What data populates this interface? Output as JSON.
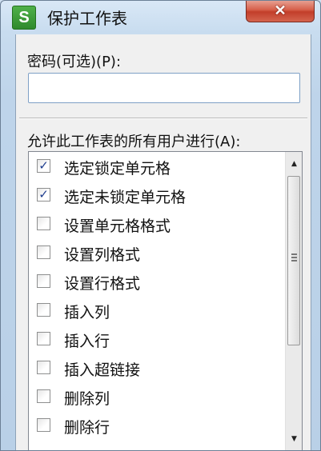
{
  "window": {
    "title": "保护工作表",
    "app_logo": "S",
    "close_symbol": "✕"
  },
  "password": {
    "label": "密码(可选)(P):",
    "value": "",
    "placeholder": ""
  },
  "permissions": {
    "label": "允许此工作表的所有用户进行(A):",
    "items": [
      {
        "label": "选定锁定单元格",
        "checked": true,
        "mark": "✓"
      },
      {
        "label": "选定未锁定单元格",
        "checked": true,
        "mark": "✓"
      },
      {
        "label": "设置单元格格式",
        "checked": false,
        "mark": ""
      },
      {
        "label": "设置列格式",
        "checked": false,
        "mark": ""
      },
      {
        "label": "设置行格式",
        "checked": false,
        "mark": ""
      },
      {
        "label": "插入列",
        "checked": false,
        "mark": ""
      },
      {
        "label": "插入行",
        "checked": false,
        "mark": ""
      },
      {
        "label": "插入超链接",
        "checked": false,
        "mark": ""
      },
      {
        "label": "删除列",
        "checked": false,
        "mark": ""
      },
      {
        "label": "删除行",
        "checked": false,
        "mark": ""
      }
    ]
  },
  "scrollbar": {
    "up_arrow": "▲",
    "down_arrow": "▼"
  },
  "colors": {
    "accent": "#1f3e8f",
    "close_button": "#c23e2a",
    "app_logo": "#2f8a2c"
  }
}
